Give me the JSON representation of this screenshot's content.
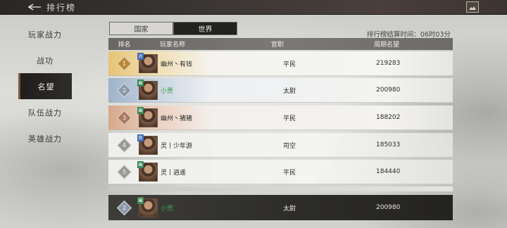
{
  "topbar": {
    "title": "排行榜",
    "back_icon": "back-arrow-icon",
    "corner_icon": "image-icon"
  },
  "sidebar": {
    "items": [
      {
        "label": "玩家战力",
        "active": false
      },
      {
        "label": "战功",
        "active": false
      },
      {
        "label": "名望",
        "active": true
      },
      {
        "label": "队伍战力",
        "active": false
      },
      {
        "label": "英雄战力",
        "active": false
      }
    ]
  },
  "tabs": [
    {
      "label": "国家",
      "active": false
    },
    {
      "label": "世界",
      "active": true
    }
  ],
  "settle_time": "排行榜结算时间：06时03分",
  "table": {
    "headers": {
      "rank": "排名",
      "name": "玩家名称",
      "title": "官职",
      "rep": "周期名望"
    },
    "rows": [
      {
        "rank": "1",
        "tag": "凉",
        "name": "幽州丶有钱",
        "title": "平民",
        "rep": "219283"
      },
      {
        "rank": "2",
        "tag": "幽",
        "name": "小贾",
        "title": "太尉",
        "rep": "200980"
      },
      {
        "rank": "3",
        "tag": "幽",
        "name": "幽州丶猪猪",
        "title": "平民",
        "rep": "188202"
      },
      {
        "rank": "4",
        "tag": "荆",
        "name": "灵丨少年游",
        "title": "司空",
        "rep": "185033"
      },
      {
        "rank": "5",
        "tag": "幽",
        "name": "灵丨逍遥",
        "title": "平民",
        "rep": "184440"
      }
    ],
    "mine": {
      "rank": "2",
      "tag": "幽",
      "name": "小贾",
      "title": "太尉",
      "rep": "200980"
    }
  },
  "colors": {
    "accent_green": "#3e9a4a",
    "active_bg": "#222220"
  }
}
